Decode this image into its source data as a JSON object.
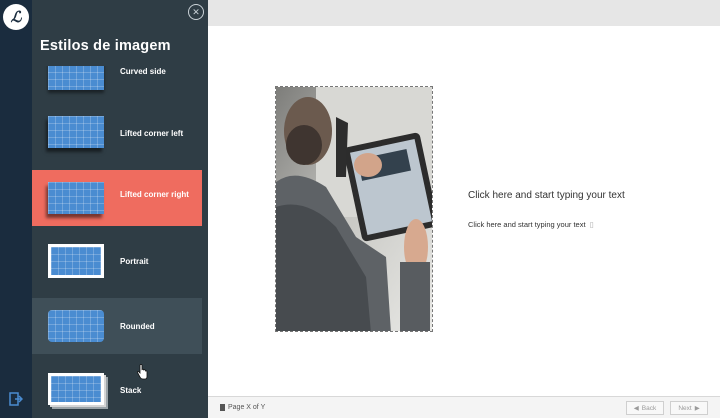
{
  "panel": {
    "title": "Estilos de imagem",
    "items": [
      {
        "label": "Curved side"
      },
      {
        "label": "Lifted corner left"
      },
      {
        "label": "Lifted corner right"
      },
      {
        "label": "Portrait"
      },
      {
        "label": "Rounded"
      },
      {
        "label": "Stack"
      }
    ]
  },
  "canvas": {
    "heading_text": "Click here and start typing your text",
    "body_text": "Click here and start typing your text"
  },
  "footer": {
    "page_indicator": "Page X of Y",
    "back_label": "Back",
    "next_label": "Next"
  },
  "colors": {
    "accent": "#ef6c5f",
    "panel_bg": "#2f3d45",
    "rail_bg": "#1a2c3e",
    "thumb_blue": "#4a8cd1"
  }
}
